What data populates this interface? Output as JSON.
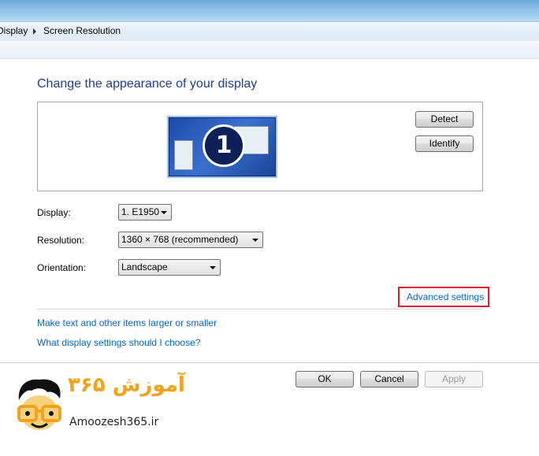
{
  "breadcrumb": {
    "items": [
      "Display",
      "Screen Resolution"
    ]
  },
  "heading": "Change the appearance of your display",
  "preview": {
    "monitor_number": "1",
    "detect_label": "Detect",
    "identify_label": "Identify"
  },
  "settings": {
    "display_label": "Display:",
    "display_value": "1. E1950",
    "resolution_label": "Resolution:",
    "resolution_value": "1360 × 768 (recommended)",
    "orientation_label": "Orientation:",
    "orientation_value": "Landscape"
  },
  "links": {
    "advanced": "Advanced settings",
    "larger_text": "Make text and other items larger or smaller",
    "which_settings": "What display settings should I choose?"
  },
  "footer": {
    "ok_label": "OK",
    "cancel_label": "Cancel",
    "apply_label": "Apply"
  },
  "watermark": {
    "brand_fa": "آموزش ۳۶۵",
    "brand_en": "Amoozesh365.ir"
  },
  "colors": {
    "heading": "#1e3f8c",
    "link": "#0066cc",
    "highlight": "#e0202a",
    "logo_orange": "#f2a31b"
  }
}
